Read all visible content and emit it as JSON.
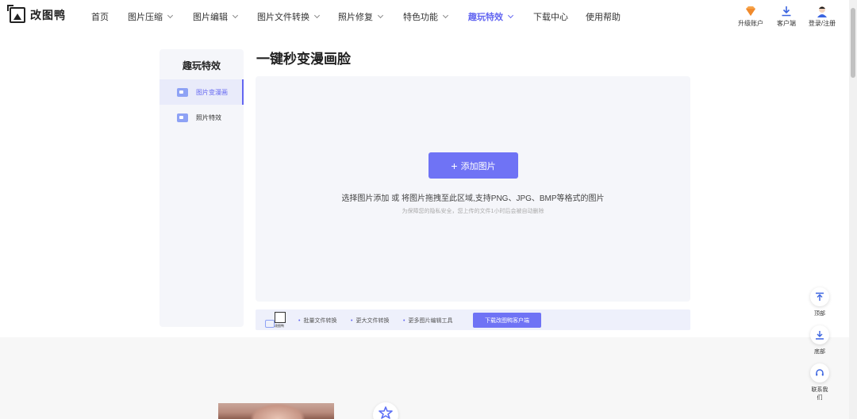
{
  "brand": {
    "name": "改图鸭"
  },
  "nav": {
    "items": [
      {
        "label": "首页",
        "dropdown": false,
        "active": false
      },
      {
        "label": "图片压缩",
        "dropdown": true,
        "active": false
      },
      {
        "label": "图片编辑",
        "dropdown": true,
        "active": false
      },
      {
        "label": "图片文件转换",
        "dropdown": true,
        "active": false
      },
      {
        "label": "照片修复",
        "dropdown": true,
        "active": false
      },
      {
        "label": "特色功能",
        "dropdown": true,
        "active": false
      },
      {
        "label": "趣玩特效",
        "dropdown": true,
        "active": true
      },
      {
        "label": "下载中心",
        "dropdown": false,
        "active": false
      },
      {
        "label": "使用帮助",
        "dropdown": false,
        "active": false
      }
    ]
  },
  "header_actions": {
    "upgrade": "升级账户",
    "client": "客户端",
    "login": "登录/注册"
  },
  "sidebar": {
    "title": "趣玩特效",
    "items": [
      {
        "label": "图片变漫画",
        "active": true
      },
      {
        "label": "照片特效",
        "active": false
      }
    ]
  },
  "main": {
    "title": "一键秒变漫画脸",
    "add_button": "添加图片",
    "hint": "选择图片添加 或 将图片拖拽至此区域,支持PNG、JPG、BMP等格式的图片",
    "privacy_note": "为保障您的隐私安全，您上传的文件1小时后会被自动删除"
  },
  "promo": {
    "logo_caption": "改图鸭",
    "features": [
      "批量文件转换",
      "更大文件转换",
      "更多图片编辑工具"
    ],
    "button": "下载改图鸭客户端"
  },
  "float": {
    "top": "顶部",
    "bottom": "底部",
    "contact": "联系我们"
  },
  "colors": {
    "accent": "#6366f1",
    "button": "#6f73f5",
    "panel": "#f5f6fa"
  }
}
